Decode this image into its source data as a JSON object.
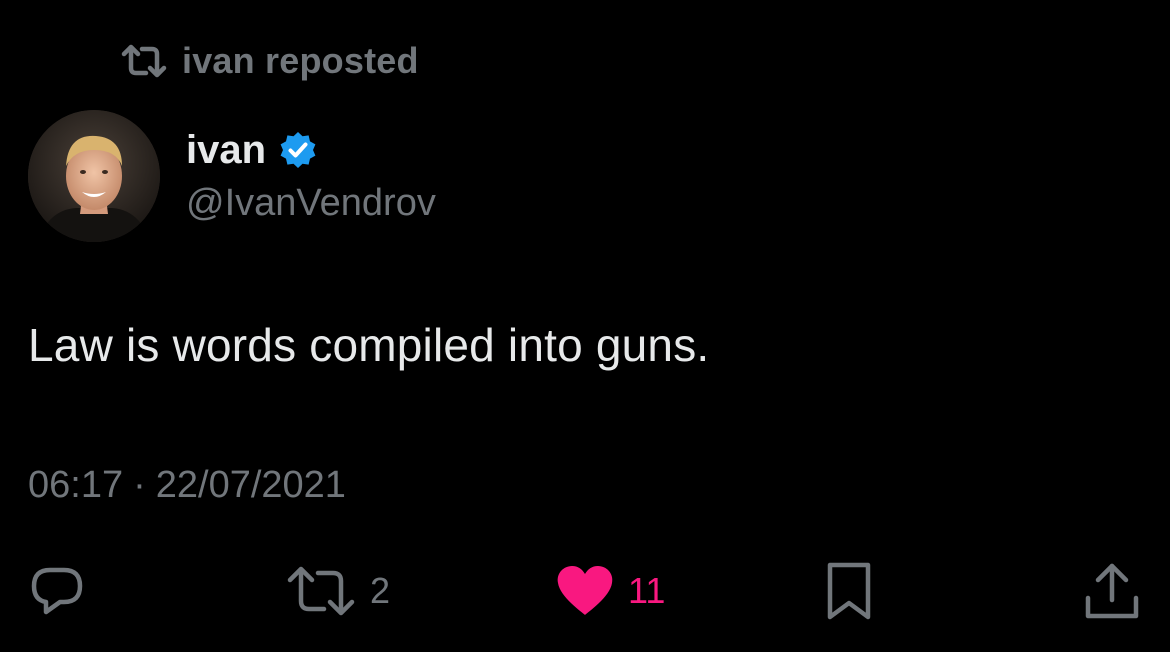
{
  "repost_banner": {
    "text": "ivan reposted",
    "icon": "repost-icon"
  },
  "author": {
    "display_name": "ivan",
    "handle": "@IvanVendrov",
    "verified": true,
    "verified_color": "#1d9bf0"
  },
  "tweet": {
    "text": "Law is words compiled into guns."
  },
  "timestamp": {
    "time": "06:17",
    "separator": "·",
    "date": "22/07/2021"
  },
  "actions": {
    "reply": {
      "icon": "reply-icon"
    },
    "repost": {
      "icon": "repost-icon",
      "count": "2"
    },
    "like": {
      "icon": "heart-icon",
      "count": "11",
      "active": true,
      "color": "#f91880"
    },
    "bookmark": {
      "icon": "bookmark-icon"
    },
    "share": {
      "icon": "share-icon"
    }
  },
  "colors": {
    "background": "#000000",
    "primary_text": "#e7e9ea",
    "secondary_text": "#71767b",
    "like": "#f91880"
  }
}
